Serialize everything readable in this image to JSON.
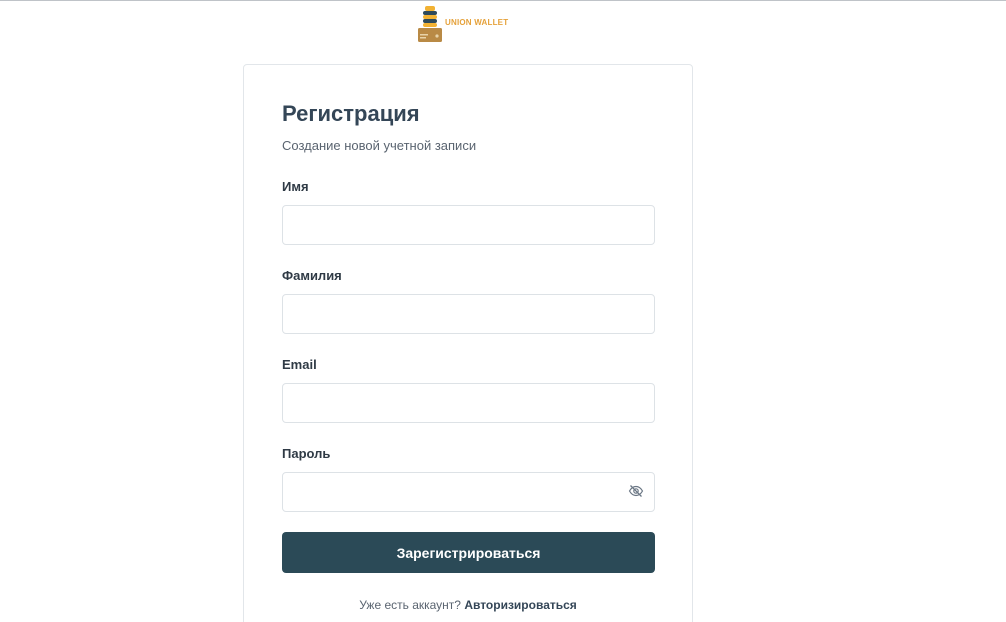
{
  "brand": {
    "name": "UNION WALLET",
    "color": "#e5a13a"
  },
  "form": {
    "title": "Регистрация",
    "subtitle": "Создание новой учетной записи",
    "fields": {
      "first_name": {
        "label": "Имя",
        "value": ""
      },
      "last_name": {
        "label": "Фамилия",
        "value": ""
      },
      "email": {
        "label": "Email",
        "value": ""
      },
      "password": {
        "label": "Пароль",
        "value": ""
      }
    },
    "submit_label": "Зарегистрироваться",
    "submit_color": "#2b4a57",
    "footer_prompt": "Уже есть аккаунт?",
    "footer_link": "Авторизироваться"
  }
}
